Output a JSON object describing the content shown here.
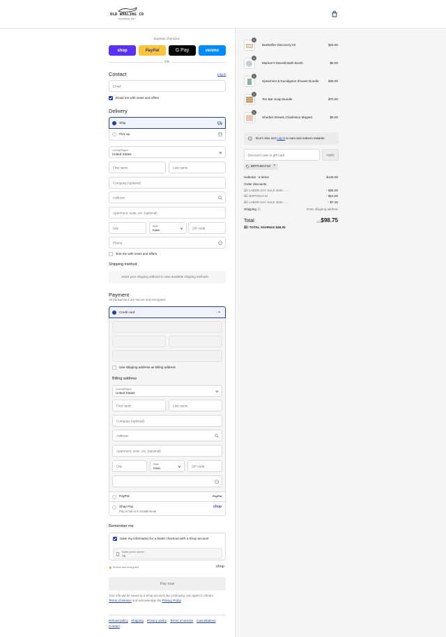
{
  "header": {
    "logo_top": "OLD WHALING CO",
    "logo_bottom": "SAVANNAH, EST.",
    "cart_icon": "shopping-bag-icon"
  },
  "express": {
    "title": "Express checkout",
    "or": "OR",
    "buttons": [
      "shop",
      "PayPal",
      "G Pay",
      "venmo"
    ],
    "colors": {
      "shop": "#5a31f4",
      "paypal": "#ffc439",
      "gpay": "#000000",
      "venmo": "#008cff"
    }
  },
  "contact": {
    "title": "Contact",
    "login": "Log in",
    "email_placeholder": "Email",
    "news_label": "Email me with news and offers"
  },
  "delivery": {
    "title": "Delivery",
    "ship": "Ship",
    "pickup": "Pick up",
    "country_label": "Country/Region",
    "country_value": "United States",
    "first_name": "First name",
    "last_name": "Last name",
    "company": "Company (optional)",
    "address": "Address",
    "apartment": "Apartment, suite, etc. (optional)",
    "city": "City",
    "state_label": "State",
    "state_value": "Iowa",
    "zip": "ZIP code",
    "phone": "Phone",
    "text_label": "Text me with news and offers"
  },
  "shipping": {
    "title": "Shipping method",
    "notice": "Enter your shipping address to view available shipping methods."
  },
  "payment": {
    "title": "Payment",
    "subtitle": "All transactions are secure and encrypted.",
    "credit_card": "Credit card",
    "use_shipping": "Use shipping address as billing address",
    "billing_title": "Billing address",
    "paypal": "PayPal",
    "paypal_logo": "PayPal",
    "shoppay": "Shop Pay",
    "shoppay_sub": "Pay in full or in installments",
    "shoppay_logo": "shop"
  },
  "remember": {
    "title": "Remember me",
    "save_label": "Save my information for a faster checkout with a Shop account",
    "mobile_label": "Mobile phone number",
    "mobile_value": "+1",
    "secure": "Secure and encrypted",
    "shop_logo": "shop"
  },
  "pay_now": "Pay now",
  "disclaimer": {
    "line1": "Your info will be saved to a Shop account. By continuing, you agree to Shop's",
    "terms": "Terms of Service",
    "mid": " and acknowledge the ",
    "privacy": "Privacy Policy",
    "end": "."
  },
  "footer": [
    "Refund policy",
    "Shipping",
    "Privacy policy",
    "Terms of service",
    "Cancellations",
    "Contact"
  ],
  "summary": {
    "items": [
      {
        "name": "Bestseller Discovery Kit",
        "price": "$23.00",
        "qty": "1"
      },
      {
        "name": "Mariner's Moonlit Bath Bomb",
        "price": "$6.00",
        "qty": "1"
      },
      {
        "name": "Spearmint & Eucalyptus Shower Bundle",
        "price": "$36.00",
        "qty": "1"
      },
      {
        "name": "Ten Bar Soap Bundle",
        "price": "$70.00",
        "qty": "1"
      },
      {
        "name": "Sherbet Streets Charleston Magnet",
        "price": "$8.00",
        "qty": "1"
      }
    ],
    "rewards_pre": "Don't miss out! ",
    "rewards_link": "Log in",
    "rewards_post": " to earn and redeem rewards",
    "discount_placeholder": "Discount code or gift card",
    "apply": "Apply",
    "code_tag": "BIRTHDAY10",
    "subtotal_label": "Subtotal · 5 items",
    "subtotal": "$145.00",
    "order_discounts": "Order discounts",
    "discounts": [
      {
        "name": "LABOR DAY SALE 2025 - ...",
        "amount": "- $29.00"
      },
      {
        "name": "BIRTHDAY10",
        "amount": "- $10.00"
      },
      {
        "name": "LABOR DAY SALE 2025 - ...",
        "amount": "- $7.25"
      }
    ],
    "shipping_label": "Shipping",
    "shipping_value": "Enter shipping address",
    "total_label": "Total",
    "currency": "USD",
    "total": "$98.75",
    "savings_label": "TOTAL SAVINGS",
    "savings": "$46.25"
  }
}
